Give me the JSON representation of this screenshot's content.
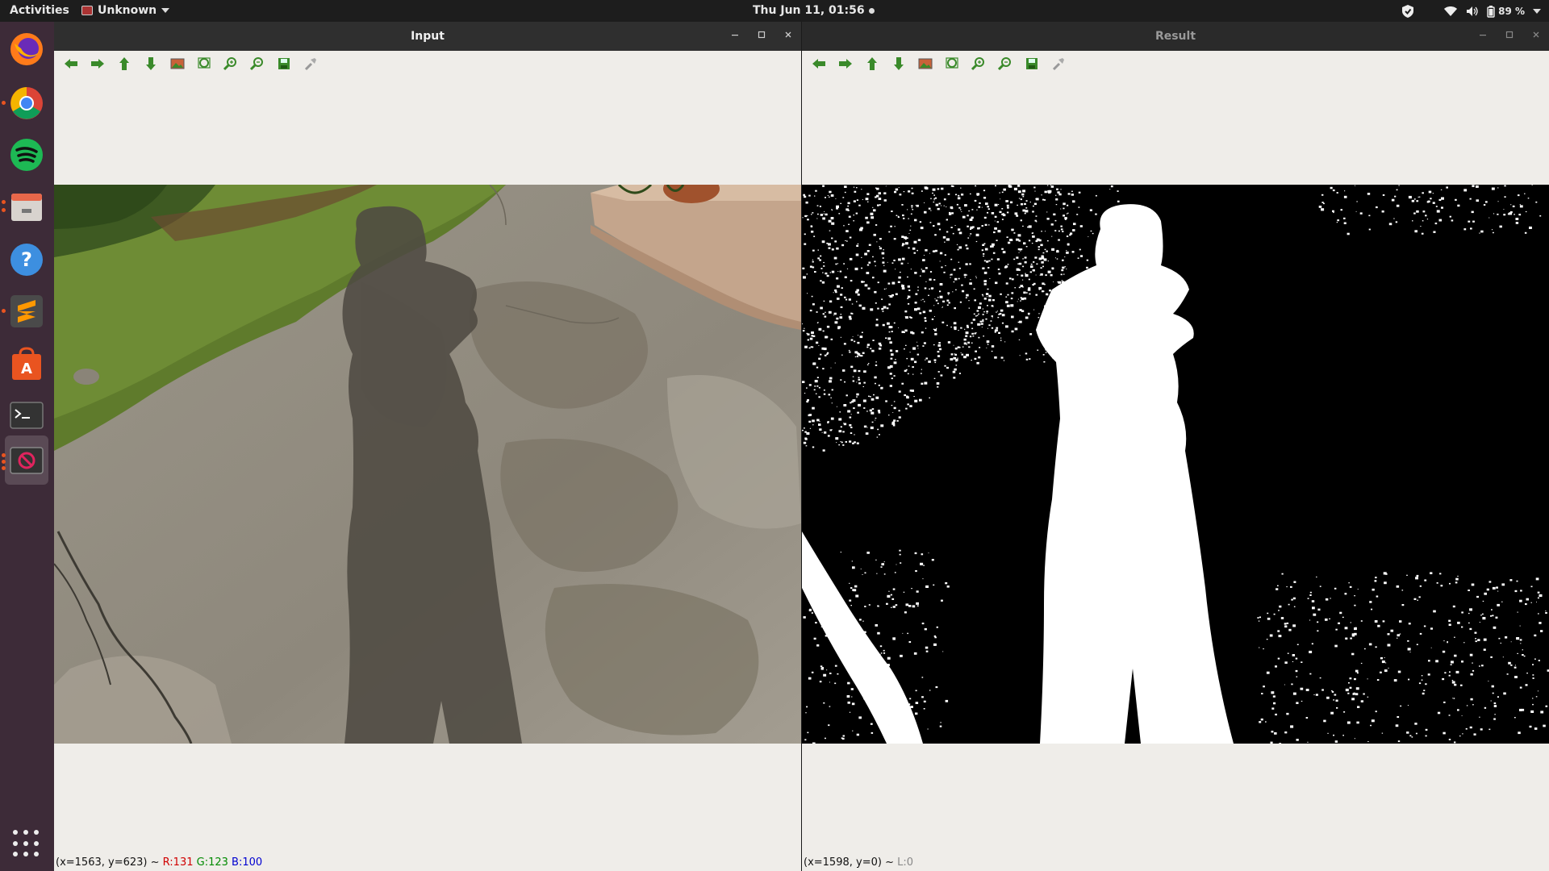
{
  "topbar": {
    "activities": "Activities",
    "app_name": "Unknown",
    "clock": "Thu Jun 11, 01:56",
    "battery": "89 %"
  },
  "dock": {
    "items": [
      {
        "name": "firefox-icon"
      },
      {
        "name": "chrome-icon"
      },
      {
        "name": "spotify-icon"
      },
      {
        "name": "files-icon"
      },
      {
        "name": "help-icon"
      },
      {
        "name": "sublime-text-icon"
      },
      {
        "name": "software-center-icon"
      },
      {
        "name": "terminal-icon"
      },
      {
        "name": "opencv-window-icon"
      }
    ]
  },
  "windows": {
    "input": {
      "title": "Input",
      "status": {
        "coords": "(x=1563, y=623) ~",
        "r": "R:131",
        "g": "G:123",
        "b": "B:100"
      }
    },
    "result": {
      "title": "Result",
      "status": {
        "coords": "(x=1598, y=0) ~",
        "l": "L:0"
      }
    }
  },
  "toolbar_icons": [
    "arrow-left-icon",
    "arrow-right-icon",
    "arrow-up-icon",
    "arrow-down-icon",
    "image-icon",
    "zoom-fit-icon",
    "zoom-in-icon",
    "zoom-out-icon",
    "save-icon",
    "properties-icon"
  ],
  "colors": {
    "toolbar_green": "#3a8a2a",
    "status_r": "#d00000",
    "status_g": "#008a00",
    "status_b": "#0000d0",
    "status_l": "#888888"
  }
}
